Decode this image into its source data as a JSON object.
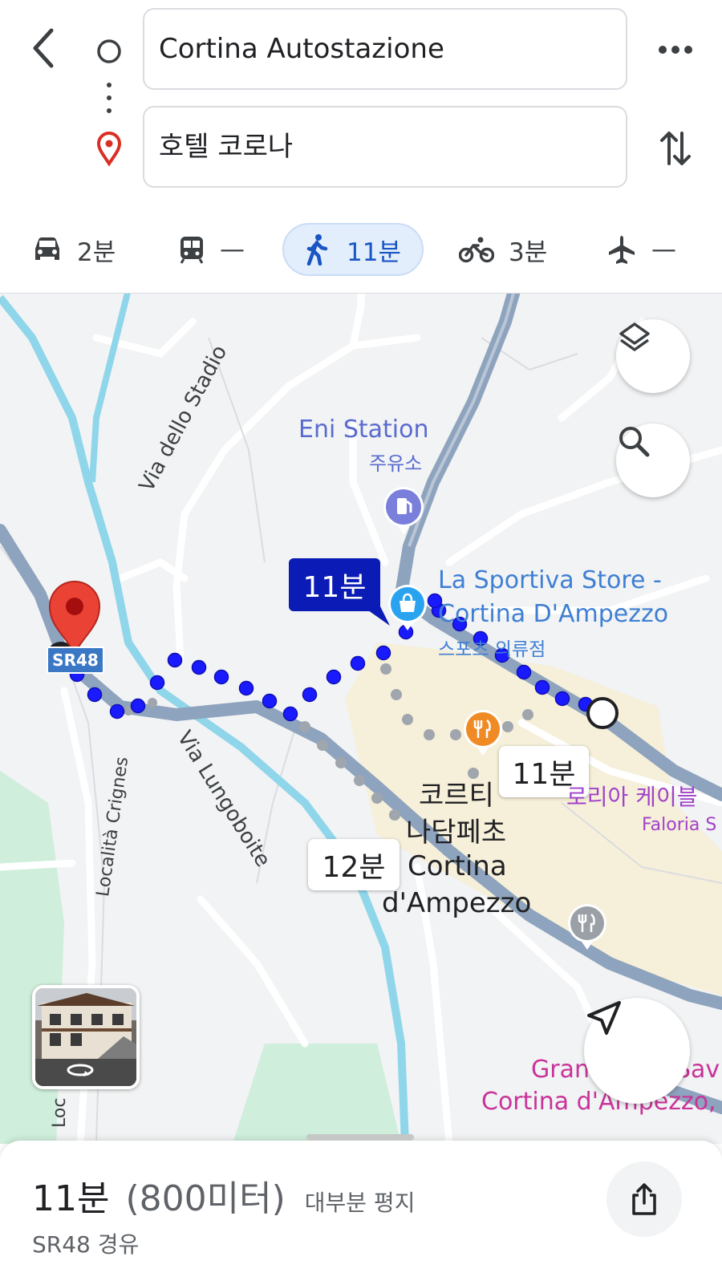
{
  "search": {
    "origin": "Cortina Autostazione",
    "destination": "호텔 코로나"
  },
  "modes": [
    {
      "icon": "car-icon",
      "label": "2분"
    },
    {
      "icon": "transit-icon",
      "label": "—"
    },
    {
      "icon": "walk-icon",
      "label": "11분",
      "active": true
    },
    {
      "icon": "bicycle-icon",
      "label": "3분"
    },
    {
      "icon": "flight-icon",
      "label": "—"
    }
  ],
  "map": {
    "roads": {
      "via_dello_stadio": "Via dello Stadio",
      "via_lungoboite": "Via Lungoboite",
      "localita_crignes": "Località Crignes",
      "localita_crignes_cut": "Loc"
    },
    "pois": {
      "eni_name": "Eni Station",
      "eni_category": "주유소",
      "sportiva_line1": "La Sportiva Store -",
      "sportiva_line2": "Cortina D'Ampezzo",
      "sportiva_category": "스포츠 의류점",
      "cortina_kr_line1": "코르티",
      "cortina_kr_line2": "나담페초",
      "cortina_line1": "Cortina",
      "cortina_line2": "d'Ampezzo",
      "faloria_kr": "로리아 케이블",
      "faloria": "Faloria S",
      "grand_line1": "Grand",
      "grand_line2": "Sav",
      "grand_line3": "Cortina d'Ampezzo,"
    },
    "route_badge": "11분",
    "alt_time_1": "11분",
    "alt_time_2": "12분",
    "highway_shield": "SR48"
  },
  "summary": {
    "duration": "11분",
    "distance": "(800미터)",
    "terrain": "대부분 평지",
    "via": "SR48 경유"
  },
  "colors": {
    "route": "#1a1aff",
    "accent": "#1a55c4",
    "pin": "#d93025",
    "river": "#8fd6ea",
    "major_road": "#8ea3bd",
    "town": "#f6efd9",
    "park": "#cfeedb"
  }
}
